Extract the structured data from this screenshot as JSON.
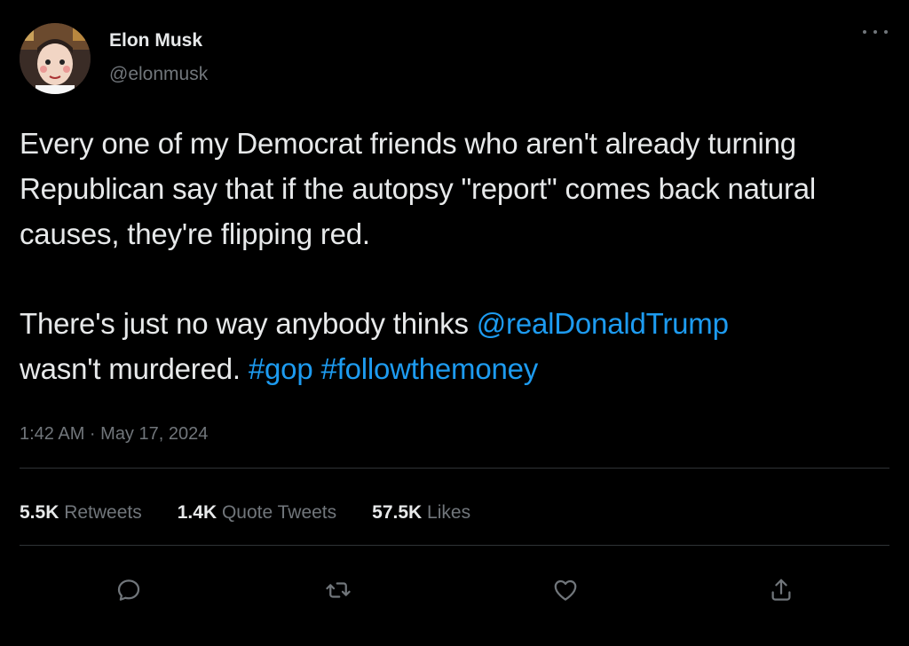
{
  "author": {
    "display_name": "Elon Musk",
    "handle": "@elonmusk",
    "avatar_icon": "cartoon-portrait-avatar"
  },
  "tweet": {
    "paragraph1": "Every one of my Democrat friends who aren't already turning Republican say that if the autopsy \"report\" comes back natural causes, they're flipping red.",
    "paragraph2_text": "There's just no way anybody thinks ",
    "mention": "@realDonaldTrump",
    "paragraph2_line2": " wasn't murdered. ",
    "hashtag1": "#gop",
    "hashtag_sep": " ",
    "hashtag2": "#followthemoney"
  },
  "meta": {
    "time": "1:42 AM · May 17, 2024"
  },
  "stats": {
    "retweets_count": "5.5K",
    "retweets_label": "Retweets",
    "quotes_count": "1.4K",
    "quotes_label": "Quote Tweets",
    "likes_count": "57.5K",
    "likes_label": "Likes"
  },
  "actions": {
    "reply_icon": "reply-icon",
    "retweet_icon": "retweet-icon",
    "like_icon": "heart-icon",
    "share_icon": "share-icon"
  },
  "colors": {
    "background": "#000000",
    "text": "#e7e9ea",
    "secondary": "#71767b",
    "link": "#1d9bf0",
    "divider": "#2f3336"
  }
}
